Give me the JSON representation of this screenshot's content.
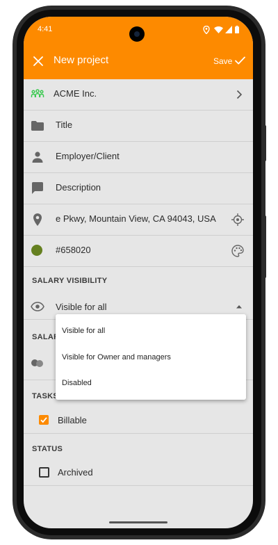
{
  "status": {
    "time": "4:41"
  },
  "appbar": {
    "title": "New project",
    "save_label": "Save"
  },
  "fields": {
    "company": "ACME Inc.",
    "title": "Title",
    "employer": "Employer/Client",
    "description": "Description",
    "address": "e Pkwy, Mountain View, CA 94043, USA",
    "color_value": "#658020"
  },
  "salary_visibility": {
    "section": "SALARY VISIBILITY",
    "selected": "Visible for all"
  },
  "salary_section_partial": "SALAR",
  "tasks_section_partial": "TASKS",
  "dropdown": {
    "options": [
      "Visible for all",
      "Visible for Owner and managers",
      "Disabled"
    ]
  },
  "billable": {
    "label": "Billable",
    "checked": true
  },
  "status_section": {
    "section": "STATUS",
    "archived_label": "Archived",
    "checked": false
  },
  "colors": {
    "accent": "#fd8a00",
    "color_swatch": "#658020",
    "company_icon": "#39c94f"
  }
}
